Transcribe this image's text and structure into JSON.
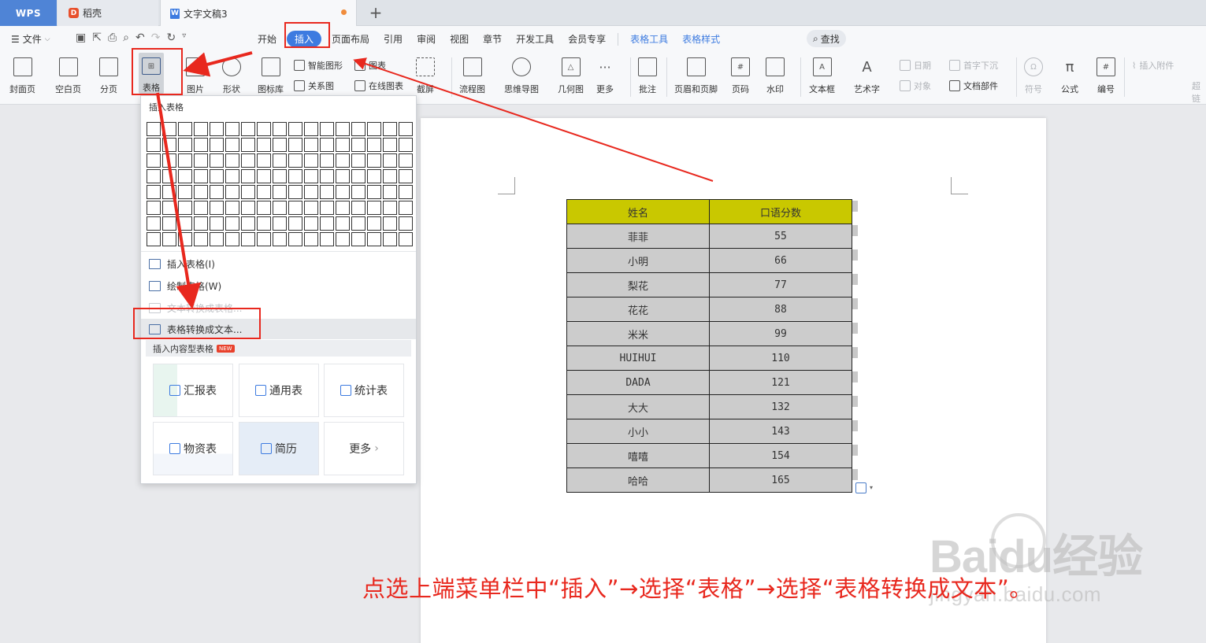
{
  "tabs": {
    "wps": "WPS",
    "daoke": "稻壳",
    "doc": "文字文稿3",
    "new_tab": "+"
  },
  "menu": {
    "file": "文件",
    "items": [
      "开始",
      "插入",
      "页面布局",
      "引用",
      "审阅",
      "视图",
      "章节",
      "开发工具",
      "会员专享"
    ],
    "context_items": [
      "表格工具",
      "表格样式"
    ],
    "search": "查找"
  },
  "ribbon": {
    "cover": "封面页",
    "blank": "空白页",
    "pagebreak": "分页",
    "table": "表格",
    "picture": "图片",
    "shape": "形状",
    "iconlib": "图标库",
    "smartart": "智能图形",
    "chart": "图表",
    "relation": "关系图",
    "onlinechart": "在线图表",
    "screenshot": "截屏",
    "flowchart": "流程图",
    "mindmap": "思维导图",
    "geometry": "几何图",
    "more": "更多",
    "comment": "批注",
    "headerfooter": "页眉和页脚",
    "pagenum": "页码",
    "watermark": "水印",
    "textbox": "文本框",
    "wordart": "艺术字",
    "date": "日期",
    "dropcap": "首字下沉",
    "object": "对象",
    "docpart": "文档部件",
    "symbol": "符号",
    "formula": "公式",
    "numbering": "编号",
    "attach": "插入附件",
    "hyperlink": "超链"
  },
  "dropdown": {
    "title": "插入表格",
    "grid_rows": 8,
    "grid_cols": 17,
    "insert_table": "插入表格(I)",
    "draw_table": "绘制表格(W)",
    "text_to_table": "文本转换成表格...",
    "table_to_text": "表格转换成文本...",
    "content_section": "插入内容型表格",
    "new_badge": "NEW",
    "templates": [
      "汇报表",
      "通用表",
      "统计表",
      "物资表",
      "简历",
      "更多"
    ],
    "more_chevron": "›"
  },
  "table": {
    "headers": [
      "姓名",
      "口语分数"
    ],
    "rows": [
      [
        "菲菲",
        "55"
      ],
      [
        "小明",
        "66"
      ],
      [
        "梨花",
        "77"
      ],
      [
        "花花",
        "88"
      ],
      [
        "米米",
        "99"
      ],
      [
        "HUIHUI",
        "110"
      ],
      [
        "DADA",
        "121"
      ],
      [
        "大大",
        "132"
      ],
      [
        "小小",
        "143"
      ],
      [
        "嘻嘻",
        "154"
      ],
      [
        "哈哈",
        "165"
      ]
    ]
  },
  "instruction": "点选上端菜单栏中“插入”→选择“表格”→选择“表格转换成文本”。",
  "watermark": {
    "main": "Baidu经验",
    "sub": "jingyan.baidu.com"
  },
  "colors": {
    "accent": "#3d7be0",
    "header_fill": "#c9c800",
    "cell_fill": "#cccccc",
    "annotation": "#e8281e"
  }
}
